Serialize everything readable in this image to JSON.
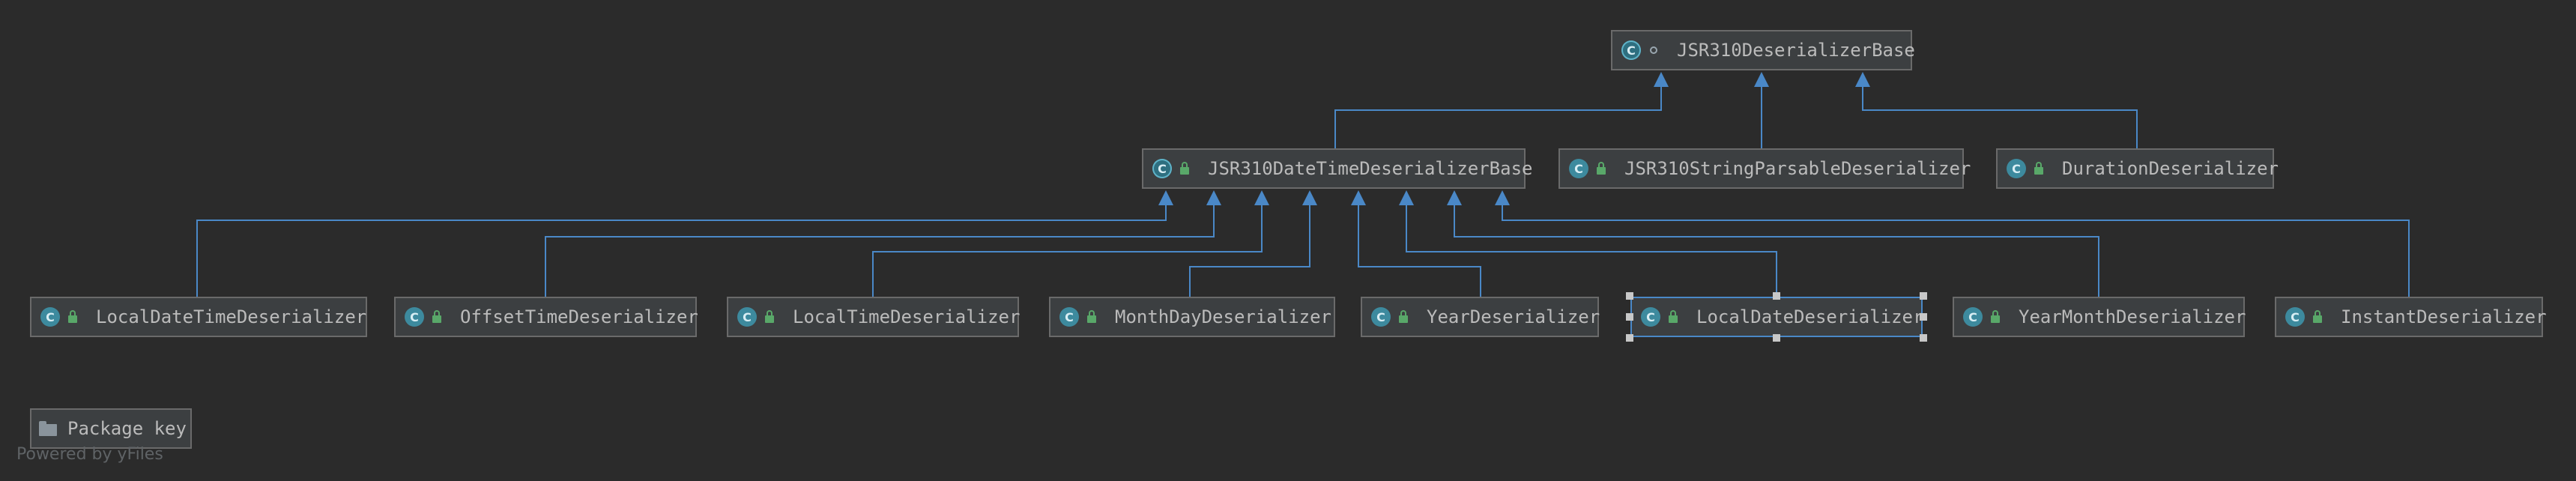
{
  "diagram": {
    "nodes": [
      {
        "id": "base",
        "label": "JSR310DeserializerBase",
        "kind": "abstract",
        "modifier": "package"
      },
      {
        "id": "dtbase",
        "label": "JSR310DateTimeDeserializerBase",
        "kind": "abstract",
        "modifier": "public"
      },
      {
        "id": "sp",
        "label": "JSR310StringParsableDeserializer",
        "kind": "class",
        "modifier": "public"
      },
      {
        "id": "dur",
        "label": "DurationDeserializer",
        "kind": "class",
        "modifier": "public"
      },
      {
        "id": "ldt",
        "label": "LocalDateTimeDeserializer",
        "kind": "class",
        "modifier": "public"
      },
      {
        "id": "ot",
        "label": "OffsetTimeDeserializer",
        "kind": "class",
        "modifier": "public"
      },
      {
        "id": "lt",
        "label": "LocalTimeDeserializer",
        "kind": "class",
        "modifier": "public"
      },
      {
        "id": "md",
        "label": "MonthDayDeserializer",
        "kind": "class",
        "modifier": "public"
      },
      {
        "id": "yr",
        "label": "YearDeserializer",
        "kind": "class",
        "modifier": "public"
      },
      {
        "id": "ld",
        "label": "LocalDateDeserializer",
        "kind": "class",
        "modifier": "public",
        "selected": true
      },
      {
        "id": "ym",
        "label": "YearMonthDeserializer",
        "kind": "class",
        "modifier": "public"
      },
      {
        "id": "inst",
        "label": "InstantDeserializer",
        "kind": "class",
        "modifier": "public"
      }
    ],
    "edges": [
      {
        "from": "dtbase",
        "to": "base"
      },
      {
        "from": "sp",
        "to": "base"
      },
      {
        "from": "dur",
        "to": "base"
      },
      {
        "from": "ldt",
        "to": "dtbase"
      },
      {
        "from": "ot",
        "to": "dtbase"
      },
      {
        "from": "lt",
        "to": "dtbase"
      },
      {
        "from": "md",
        "to": "dtbase"
      },
      {
        "from": "yr",
        "to": "dtbase"
      },
      {
        "from": "ld",
        "to": "dtbase"
      },
      {
        "from": "ym",
        "to": "dtbase"
      },
      {
        "from": "inst",
        "to": "dtbase"
      }
    ],
    "icons": {
      "class": "class-icon",
      "abstract": "abstract-class-icon",
      "public": "public-lock-icon",
      "package": "package-private-icon"
    },
    "colors": {
      "background": "#2b2b2b",
      "node_fill": "#3c3f41",
      "node_border": "#6a6a6a",
      "edge": "#4a88c7",
      "selected_border": "#4a88c7"
    }
  },
  "package_key": {
    "label": "Package key",
    "icon": "folder-icon"
  },
  "footer": {
    "powered_by": "Powered by yFiles"
  }
}
